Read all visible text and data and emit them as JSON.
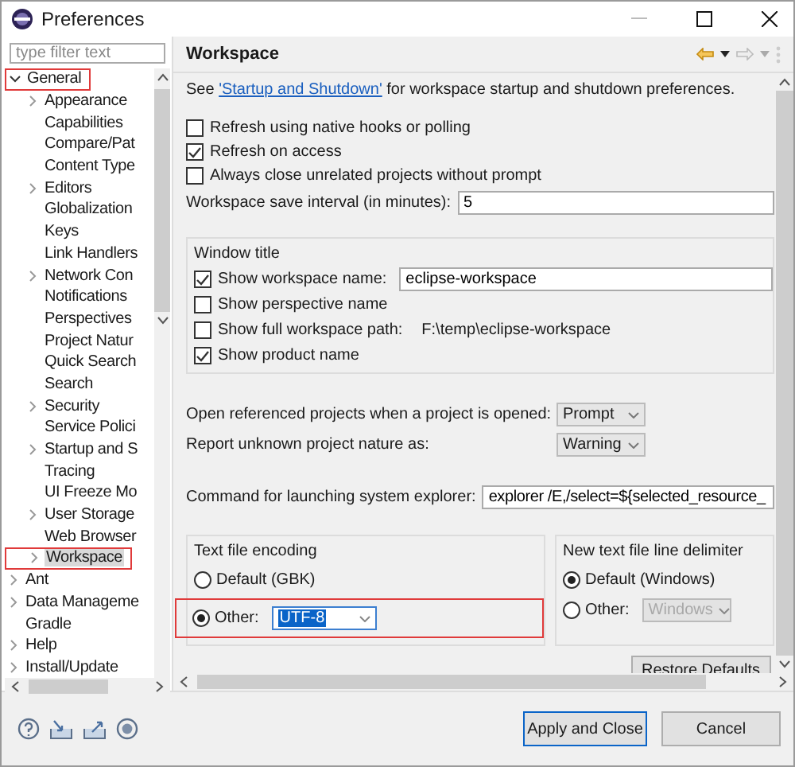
{
  "window": {
    "title": "Preferences"
  },
  "filter": {
    "placeholder": "type filter text"
  },
  "tree": [
    {
      "label": "General",
      "expanded": true,
      "selected": false,
      "highlighted": true,
      "children": [
        {
          "label": "Appearance",
          "expanded": false,
          "selected": false,
          "highlighted": false
        },
        {
          "label": "Capabilities",
          "selected": false,
          "highlighted": false
        },
        {
          "label": "Compare/Pat",
          "selected": false,
          "highlighted": false
        },
        {
          "label": "Content Type",
          "selected": false,
          "highlighted": false
        },
        {
          "label": "Editors",
          "expanded": false,
          "selected": false,
          "highlighted": false
        },
        {
          "label": "Globalization",
          "selected": false,
          "highlighted": false
        },
        {
          "label": "Keys",
          "selected": false,
          "highlighted": false
        },
        {
          "label": "Link Handlers",
          "selected": false,
          "highlighted": false
        },
        {
          "label": "Network Con",
          "expanded": false,
          "selected": false,
          "highlighted": false
        },
        {
          "label": "Notifications",
          "selected": false,
          "highlighted": false
        },
        {
          "label": "Perspectives",
          "selected": false,
          "highlighted": false
        },
        {
          "label": "Project Natur",
          "selected": false,
          "highlighted": false
        },
        {
          "label": "Quick Search",
          "selected": false,
          "highlighted": false
        },
        {
          "label": "Search",
          "selected": false,
          "highlighted": false
        },
        {
          "label": "Security",
          "expanded": false,
          "selected": false,
          "highlighted": false
        },
        {
          "label": "Service Polici",
          "selected": false,
          "highlighted": false
        },
        {
          "label": "Startup and S",
          "expanded": false,
          "selected": false,
          "highlighted": false
        },
        {
          "label": "Tracing",
          "selected": false,
          "highlighted": false
        },
        {
          "label": "UI Freeze Mo",
          "selected": false,
          "highlighted": false
        },
        {
          "label": "User Storage",
          "expanded": false,
          "selected": false,
          "highlighted": false
        },
        {
          "label": "Web Browser",
          "selected": false,
          "highlighted": false
        },
        {
          "label": "Workspace",
          "expanded": false,
          "selected": true,
          "highlighted": true
        }
      ]
    },
    {
      "label": "Ant",
      "expanded": false,
      "selected": false,
      "highlighted": false
    },
    {
      "label": "Data Manageme",
      "expanded": false,
      "selected": false,
      "highlighted": false
    },
    {
      "label": "Gradle",
      "selected": false,
      "highlighted": false
    },
    {
      "label": "Help",
      "expanded": false,
      "selected": false,
      "highlighted": false
    },
    {
      "label": "Install/Update",
      "expanded": false,
      "selected": false,
      "highlighted": false
    }
  ],
  "page": {
    "title": "Workspace",
    "intro": {
      "prefix": "See",
      "link": "'Startup and Shutdown'",
      "suffix": "for workspace startup and shutdown preferences."
    },
    "checks": [
      {
        "label": "Refresh using native hooks or polling",
        "checked": false
      },
      {
        "label": "Refresh on access",
        "checked": true
      },
      {
        "label": "Always close unrelated projects without prompt",
        "checked": false
      }
    ],
    "save_interval": {
      "label": "Workspace save interval (in minutes):",
      "value": "5"
    },
    "window_title": {
      "title": "Window title",
      "rows": [
        {
          "kind": "field",
          "label": "Show workspace name:",
          "checked": true,
          "value": "eclipse-workspace"
        },
        {
          "kind": "plain",
          "label": "Show perspective name",
          "checked": false
        },
        {
          "kind": "path",
          "label": "Show full workspace path:",
          "checked": false,
          "value": "F:\\temp\\eclipse-workspace"
        },
        {
          "kind": "plain",
          "label": "Show product name",
          "checked": true
        }
      ]
    },
    "dropdowns": [
      {
        "label": "Open referenced projects when a project is opened:",
        "value": "Prompt"
      },
      {
        "label": "Report unknown project nature as:",
        "value": "Warning"
      }
    ],
    "command": {
      "label": "Command for launching system explorer:",
      "value": "explorer /E,/select=${selected_resource_"
    },
    "encoding": {
      "title": "Text file encoding",
      "options": [
        {
          "label": "Default (GBK)",
          "selected": false,
          "highlighted": false
        },
        {
          "label": "Other:",
          "selected": true,
          "value": "UTF-8",
          "disabled": false,
          "highlighted": true
        }
      ]
    },
    "delimiter": {
      "title": "New text file line delimiter",
      "options": [
        {
          "label": "Default (Windows)",
          "selected": true,
          "highlighted": false
        },
        {
          "label": "Other:",
          "selected": false,
          "value": "Windows",
          "disabled": true,
          "highlighted": false
        }
      ]
    },
    "restore": "Restore Defaults"
  },
  "buttons": [
    {
      "label": "Apply and Close",
      "default": true
    },
    {
      "label": "Cancel",
      "default": false
    }
  ]
}
